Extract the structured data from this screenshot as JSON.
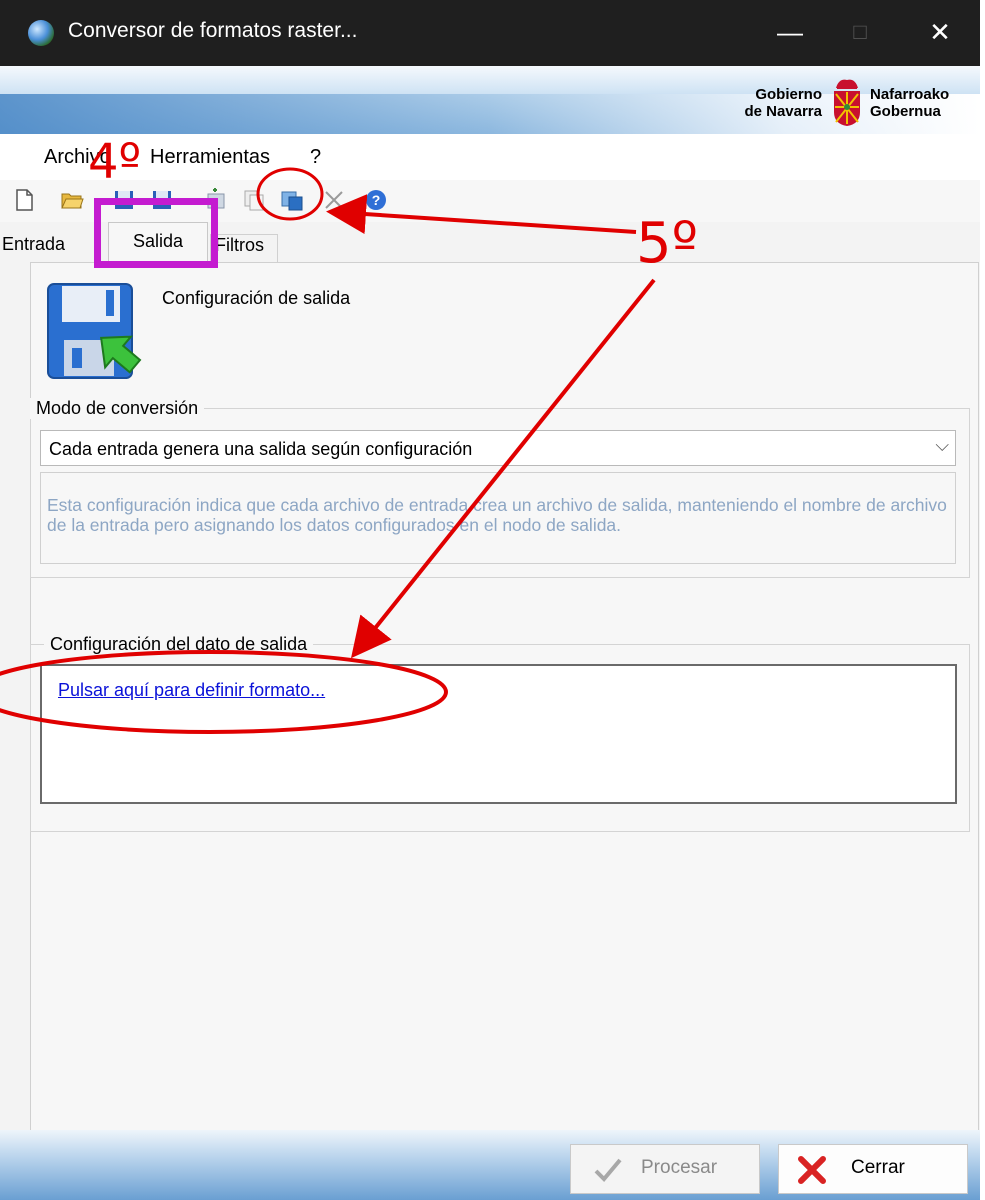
{
  "window": {
    "title": "Conversor de formatos raster...",
    "controls": {
      "minimize": "—",
      "maximize": "□",
      "close": "✕"
    }
  },
  "banner": {
    "logo_left_line1": "Gobierno",
    "logo_left_line2": "de Navarra",
    "logo_right_line1": "Nafarroako",
    "logo_right_line2": "Gobernua"
  },
  "menu": {
    "items": [
      {
        "label": "Archivo"
      },
      {
        "label": "Herramientas"
      },
      {
        "label": "?"
      }
    ]
  },
  "toolbar": {
    "icons": [
      "new-file-icon",
      "open-folder-icon",
      "save-icon",
      "save-as-icon",
      "add-icon",
      "copy-icon",
      "export-icon",
      "delete-icon",
      "help-icon"
    ]
  },
  "tabs": [
    {
      "label": "Entrada"
    },
    {
      "label": "Salida",
      "selected": true
    },
    {
      "label": "Filtros"
    }
  ],
  "salida": {
    "header": "Configuración de salida",
    "modo_legend": "Modo de conversión",
    "modo_value": "Cada entrada genera una salida según configuración",
    "modo_description": "Esta configuración indica que cada archivo de entrada crea un archivo de salida, manteniendo el nombre de archivo de la entrada pero asignando los datos configurados en el nodo de salida.",
    "dato_legend": "Configuración del dato de salida",
    "dato_link": "Pulsar aquí para definir formato..."
  },
  "footer": {
    "procesar_label": "Procesar",
    "cerrar_label": "Cerrar"
  },
  "annotations": {
    "step4": "4º",
    "step5": "5º",
    "color": "#e00000",
    "highlight_color": "#c41bd0"
  }
}
